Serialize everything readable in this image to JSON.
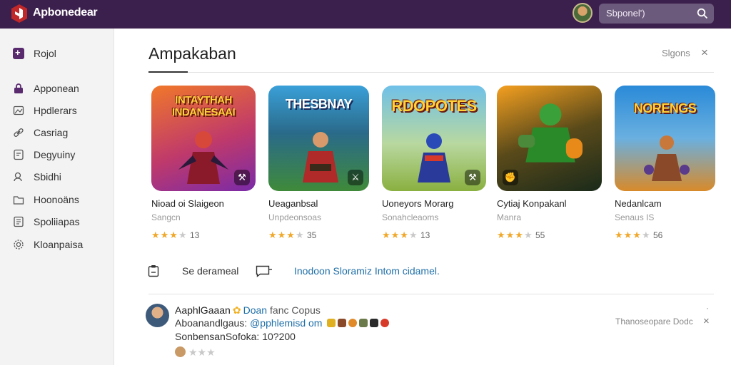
{
  "topbar": {
    "brand": "Apbonedear",
    "search_text": "Sbponel')",
    "colors": {
      "bar": "#3b1f4d",
      "search": "#6b5a7b"
    }
  },
  "sidebar": {
    "items": [
      {
        "label": "Rojol",
        "icon": "plus-square-icon"
      },
      {
        "label": "Apponean",
        "icon": "lock-icon"
      },
      {
        "label": "Hpdlerars",
        "icon": "image-icon"
      },
      {
        "label": "Casriag",
        "icon": "link-icon"
      },
      {
        "label": "Degyuiny",
        "icon": "chat-icon"
      },
      {
        "label": "Sbidhi",
        "icon": "users-icon"
      },
      {
        "label": "Hoonoäns",
        "icon": "folder-icon"
      },
      {
        "label": "Spoliiapas",
        "icon": "document-icon"
      },
      {
        "label": "Kloanpaisa",
        "icon": "gear-icon"
      }
    ]
  },
  "main": {
    "title": "Ampakaban",
    "header_link": "Slgons",
    "close": "×"
  },
  "cards": [
    {
      "thumb_title": "INTAYTHAH INDANESAAI",
      "name": "Nioad oi Slaigeon",
      "sub": "Sangcn",
      "stars": 3,
      "count": "13",
      "colors": [
        "#f0782a",
        "#7a2aa8"
      ]
    },
    {
      "thumb_title": "THESBNAY",
      "name": "Ueaganbsal",
      "sub": "Unpdeonsoas",
      "stars": 3,
      "count": "35",
      "colors": [
        "#3aa0d8",
        "#3f8a3a"
      ]
    },
    {
      "thumb_title": "RDOPOTES",
      "name": "Uoneyors Morarg",
      "sub": "Sonahcleaoms",
      "stars": 3,
      "count": "13",
      "colors": [
        "#6fc0e8",
        "#8ab040"
      ]
    },
    {
      "thumb_title": "",
      "name": "Cytiaj Konpakanl",
      "sub": "Manra",
      "stars": 3,
      "count": "55",
      "colors": [
        "#f5a020",
        "#1a2a1a"
      ]
    },
    {
      "thumb_title": "NORENGS",
      "name": "Nedanlcam",
      "sub": "Senaus IS",
      "stars": 3,
      "count": "56",
      "colors": [
        "#2a8ad8",
        "#d88a2a"
      ]
    }
  ],
  "actions": {
    "label1": "Se derameal",
    "link": "Inodoon Sloramiz Intom cidamel."
  },
  "review": {
    "name": "AaphlGaaan",
    "verified_icon": "✿",
    "tag": "Doan",
    "extra": "fanc Copus",
    "line2_prefix": "Aboanandlgaus:",
    "line2_handle": "@pphlemisd om",
    "line3": "SonbensanSofoka: 10?200",
    "right_text": "Thanoseopare Dodc",
    "close": "×",
    "dot": "·",
    "stars": "★★★"
  }
}
